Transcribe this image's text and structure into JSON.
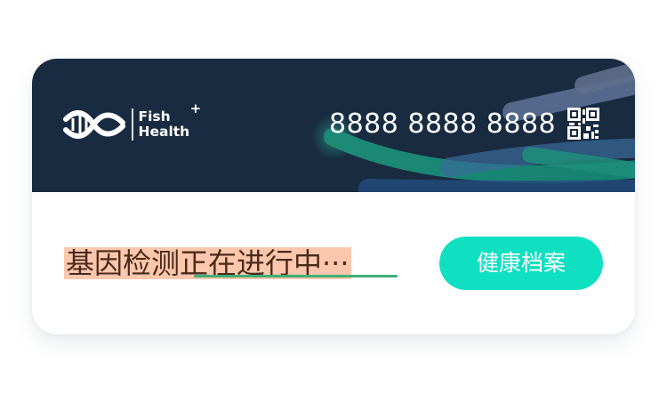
{
  "brand": {
    "name_line1": "Fish",
    "name_plus": "+",
    "name_line2": "Health"
  },
  "header": {
    "phone": "8888 8888 8888",
    "qr_icon": "qr-code-icon",
    "background_color": "#182b40"
  },
  "status": {
    "text": "基因检测正在进行中···",
    "highlight_color": "#fcc7ad",
    "underline_color": "#3faf76"
  },
  "actions": {
    "health_record_label": "健康档案",
    "button_color": "#10e0c2"
  }
}
